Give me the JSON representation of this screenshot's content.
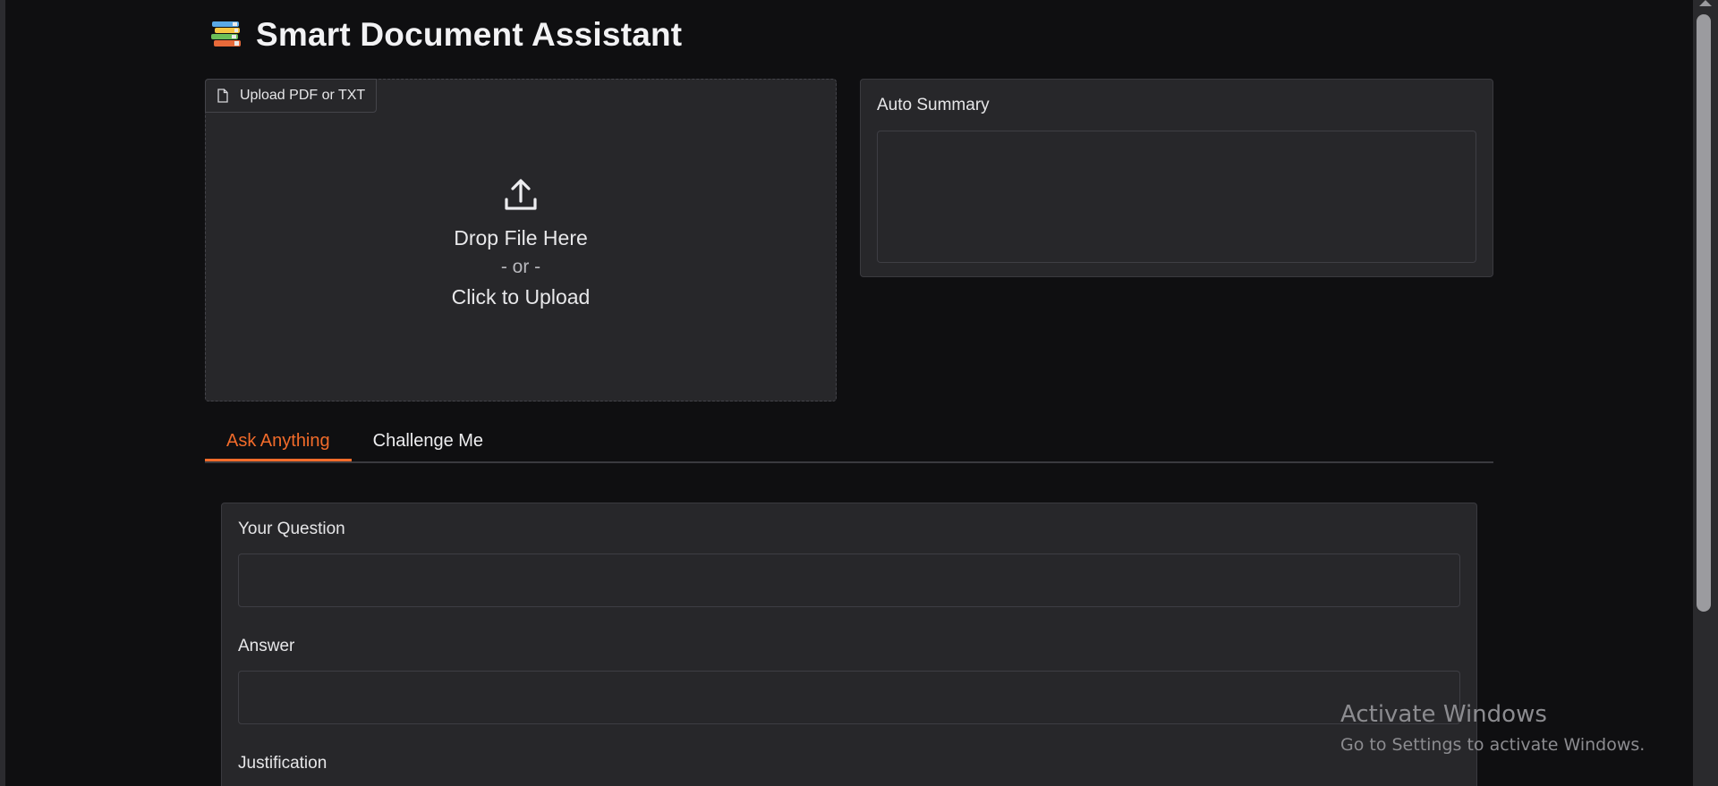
{
  "header": {
    "title": "Smart Document Assistant",
    "icon": "books-icon"
  },
  "upload": {
    "label": "Upload PDF or TXT",
    "drop_text": "Drop File Here",
    "or_text": "- or -",
    "click_text": "Click to Upload"
  },
  "summary": {
    "label": "Auto Summary",
    "value": ""
  },
  "tabs": [
    {
      "label": "Ask Anything",
      "active": true
    },
    {
      "label": "Challenge Me",
      "active": false
    }
  ],
  "qa": {
    "question_label": "Your Question",
    "question_value": "",
    "answer_label": "Answer",
    "answer_value": "",
    "justification_label": "Justification"
  },
  "watermark": {
    "title": "Activate Windows",
    "subtitle": "Go to Settings to activate Windows."
  },
  "colors": {
    "background": "#0f0f11",
    "panel": "#27272a",
    "accent": "#f26b2a",
    "border": "#3a3a3f"
  }
}
